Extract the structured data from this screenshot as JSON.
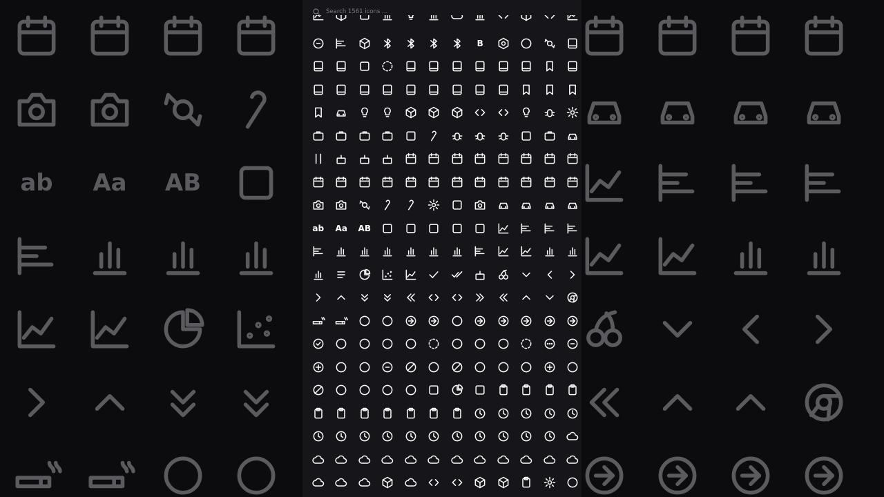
{
  "search": {
    "placeholder": "Search 1561 icons ..."
  },
  "background_left": [
    "calendar-dots-icon",
    "calendar-note-icon",
    "calendar-heart-icon",
    "calendar-minus-icon",
    "camera-icon",
    "camera-off-icon",
    "candy-icon",
    "candy-cane-icon",
    "ab",
    "Aa",
    "AB",
    "cassette-icon",
    "chart-bar-stacked-icon",
    "chart-candlestick-icon",
    "chart-bar-icon",
    "chart-column-icon",
    "chart-line-up-icon",
    "chart-lines-icon",
    "chart-pie-icon",
    "chart-scatter-icon",
    "chevron-right-icon",
    "chevron-up-icon",
    "chevrons-down-icon",
    "chevrons-down-up-icon",
    "cigarette-icon",
    "cigarette-off-icon",
    "circle-icon",
    "circle-alert-icon"
  ],
  "background_right": [
    "calendar-range-icon",
    "calendar-search-icon",
    "calendar-sync-icon",
    "calendar-x-icon",
    "car-front-icon",
    "car-icon",
    "taxi-icon",
    "caravan-icon",
    "chart-area-icon",
    "chart-bar-left-icon",
    "chart-bar-big-icon",
    "chart-bar-decreasing-icon",
    "chart-line-icon",
    "chart-spline-icon",
    "chart-no-axes-icon",
    "chart-no-axes-column-icon",
    "cherry-icon",
    "chevron-down-icon",
    "chevron-first-icon",
    "chevron-last-icon",
    "chevrons-left-right-icon",
    "chevrons-up-icon",
    "chevrons-up-down-icon",
    "chrome-icon",
    "circle-arrow-out-icon",
    "circle-arrow-out-up-icon",
    "circle-arrow-right-icon",
    "circle-arrow-up-icon"
  ],
  "grid_labels": {
    "b": "B",
    "ab": "ab",
    "aa": "Aa",
    "AB": "AB"
  }
}
